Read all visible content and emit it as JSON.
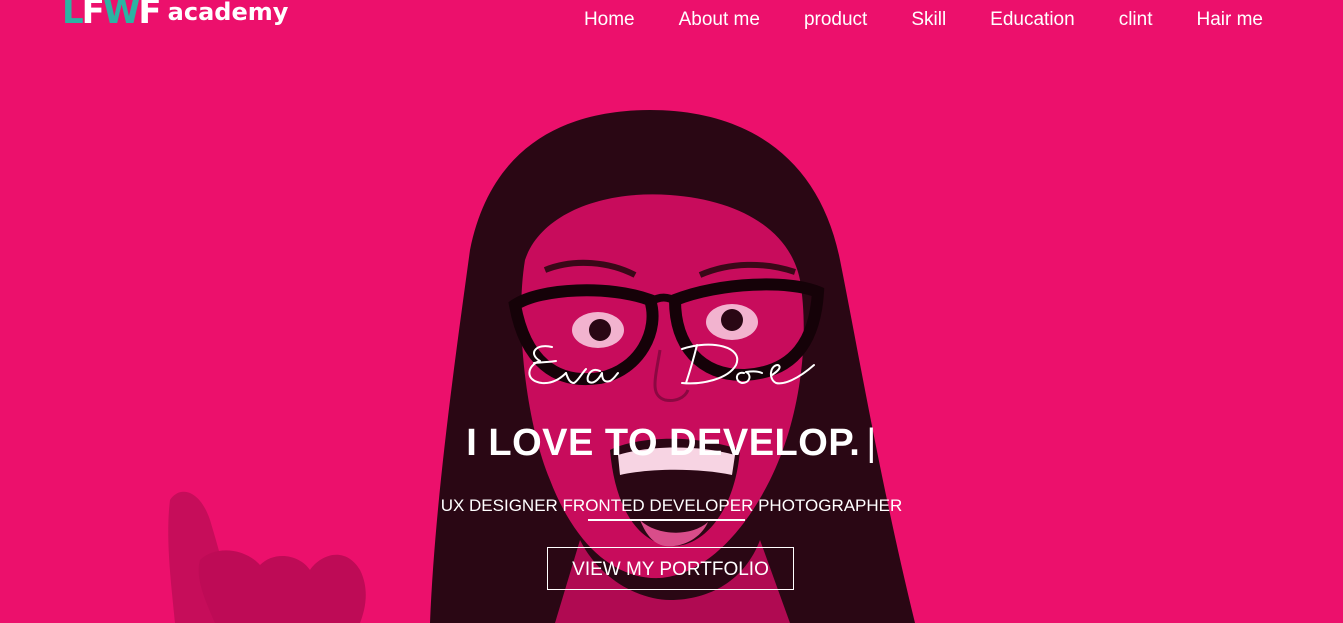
{
  "logo": {
    "mark_letters": [
      "L",
      "F",
      "W",
      "F"
    ],
    "text": "academy"
  },
  "nav": {
    "items": [
      {
        "label": "Home"
      },
      {
        "label": "About me"
      },
      {
        "label": "product"
      },
      {
        "label": "Skill"
      },
      {
        "label": "Education"
      },
      {
        "label": "clint"
      },
      {
        "label": "Hair me"
      }
    ]
  },
  "hero": {
    "signature": "Eva Doe",
    "headline": "I LOVE TO DEVELOP.",
    "cursor": "|",
    "roles": "UX DESIGNER FRONTED DEVELOPER PHOTOGRAPHER",
    "cta_label": "VIEW MY PORTFOLIO"
  },
  "colors": {
    "background": "#ec106c",
    "logo_accent": "#2bb3a3",
    "text": "#ffffff"
  }
}
